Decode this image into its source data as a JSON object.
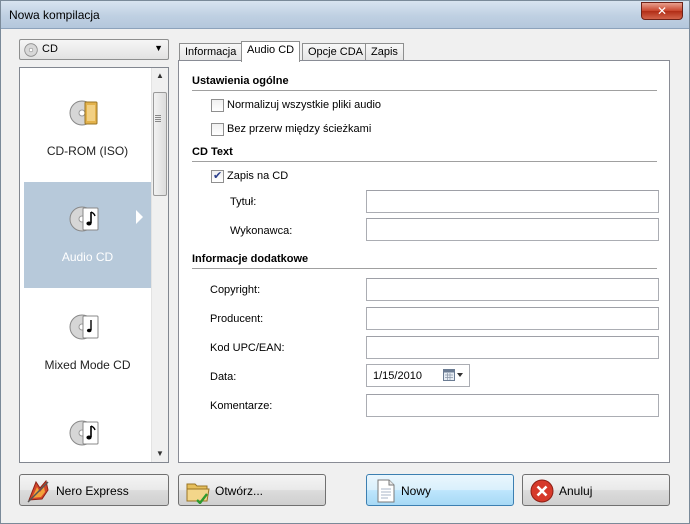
{
  "window": {
    "title": "Nowa kompilacja",
    "close_label": "✕"
  },
  "media_select": {
    "value": "CD",
    "icon": "disc-icon"
  },
  "projects": [
    {
      "label": "CD-ROM (ISO)",
      "icon": "data-disc-folder-icon",
      "selected": false
    },
    {
      "label": "Audio CD",
      "icon": "audio-disc-note-icon",
      "selected": true
    },
    {
      "label": "Mixed Mode CD",
      "icon": "mixed-disc-icon",
      "selected": false
    },
    {
      "label": "",
      "icon": "audio-disc-note-icon",
      "selected": false
    }
  ],
  "tabs": [
    "Informacja",
    "Audio CD",
    "Opcje CDA",
    "Zapis"
  ],
  "active_tab": "Audio CD",
  "general": {
    "heading": "Ustawienia ogólne",
    "normalize_label": "Normalizuj wszystkie pliki audio",
    "normalize_checked": false,
    "no_gaps_label": "Bez przerw między ścieżkami",
    "no_gaps_checked": false
  },
  "cdtext": {
    "heading": "CD Text",
    "write_label": "Zapis na CD",
    "write_checked": true,
    "title_label": "Tytuł:",
    "title_value": "",
    "artist_label": "Wykonawca:",
    "artist_value": ""
  },
  "extra": {
    "heading": "Informacje dodatkowe",
    "copyright_label": "Copyright:",
    "copyright_value": "",
    "producer_label": "Producent:",
    "producer_value": "",
    "upc_label": "Kod UPC/EAN:",
    "upc_value": "",
    "date_label": "Data:",
    "date_value": "1/15/2010",
    "comments_label": "Komentarze:",
    "comments_value": ""
  },
  "buttons": {
    "nero_express": "Nero Express",
    "open": "Otwórz...",
    "new": "Nowy",
    "cancel": "Anuluj"
  }
}
